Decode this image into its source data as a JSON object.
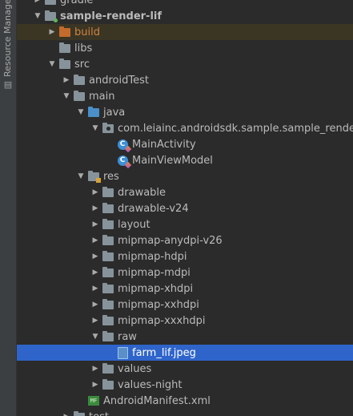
{
  "side_panel": {
    "title": "Resource Manager",
    "glyph": "▤"
  },
  "tree": [
    {
      "label": "gradle",
      "depth": 1,
      "arrow": "right",
      "icon": "folder-icon"
    },
    {
      "label": "sample-render-lif",
      "depth": 1,
      "arrow": "down",
      "icon": "module-folder-icon",
      "bold": true
    },
    {
      "label": "build",
      "depth": 2,
      "arrow": "right",
      "icon": "excluded-folder-icon",
      "style": "build"
    },
    {
      "label": "libs",
      "depth": 2,
      "arrow": "none",
      "icon": "folder-icon"
    },
    {
      "label": "src",
      "depth": 2,
      "arrow": "down",
      "icon": "folder-icon"
    },
    {
      "label": "androidTest",
      "depth": 3,
      "arrow": "right",
      "icon": "folder-icon"
    },
    {
      "label": "main",
      "depth": 3,
      "arrow": "down",
      "icon": "folder-icon"
    },
    {
      "label": "java",
      "depth": 4,
      "arrow": "down",
      "icon": "source-folder-icon"
    },
    {
      "label": "com.leiainc.androidsdk.sample.sample_render_lif",
      "depth": 5,
      "arrow": "down",
      "icon": "package-icon"
    },
    {
      "label": "MainActivity",
      "depth": 6,
      "arrow": "none",
      "icon": "kotlin-class-icon"
    },
    {
      "label": "MainViewModel",
      "depth": 6,
      "arrow": "none",
      "icon": "kotlin-class-icon"
    },
    {
      "label": "res",
      "depth": 4,
      "arrow": "down",
      "icon": "resource-folder-icon"
    },
    {
      "label": "drawable",
      "depth": 5,
      "arrow": "right",
      "icon": "folder-icon"
    },
    {
      "label": "drawable-v24",
      "depth": 5,
      "arrow": "right",
      "icon": "folder-icon"
    },
    {
      "label": "layout",
      "depth": 5,
      "arrow": "right",
      "icon": "folder-icon"
    },
    {
      "label": "mipmap-anydpi-v26",
      "depth": 5,
      "arrow": "right",
      "icon": "folder-icon"
    },
    {
      "label": "mipmap-hdpi",
      "depth": 5,
      "arrow": "right",
      "icon": "folder-icon"
    },
    {
      "label": "mipmap-mdpi",
      "depth": 5,
      "arrow": "right",
      "icon": "folder-icon"
    },
    {
      "label": "mipmap-xhdpi",
      "depth": 5,
      "arrow": "right",
      "icon": "folder-icon"
    },
    {
      "label": "mipmap-xxhdpi",
      "depth": 5,
      "arrow": "right",
      "icon": "folder-icon"
    },
    {
      "label": "mipmap-xxxhdpi",
      "depth": 5,
      "arrow": "right",
      "icon": "folder-icon"
    },
    {
      "label": "raw",
      "depth": 5,
      "arrow": "down",
      "icon": "folder-icon"
    },
    {
      "label": "farm_lif.jpeg",
      "depth": 6,
      "arrow": "none",
      "icon": "image-file-icon",
      "selected": true
    },
    {
      "label": "values",
      "depth": 5,
      "arrow": "right",
      "icon": "folder-icon"
    },
    {
      "label": "values-night",
      "depth": 5,
      "arrow": "right",
      "icon": "folder-icon"
    },
    {
      "label": "AndroidManifest.xml",
      "depth": 4,
      "arrow": "none",
      "icon": "manifest-file-icon",
      "glyph": "MF"
    },
    {
      "label": "test",
      "depth": 3,
      "arrow": "right",
      "icon": "folder-icon"
    }
  ],
  "colors": {
    "selection": "#2f65ca",
    "background": "#2b2b2b",
    "excluded_row": "#3b3524",
    "build_text": "#d08441"
  }
}
